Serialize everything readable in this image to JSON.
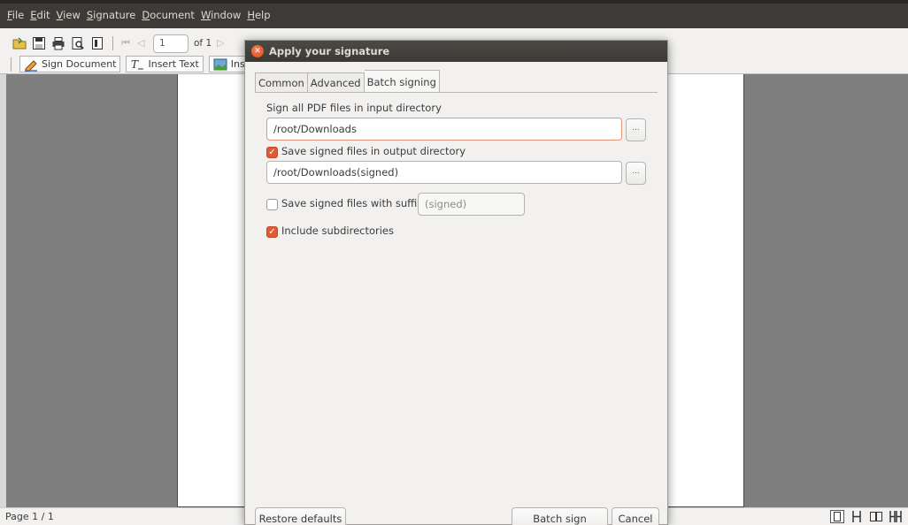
{
  "menubar": {
    "items": [
      "File",
      "Edit",
      "View",
      "Signature",
      "Document",
      "Window",
      "Help"
    ]
  },
  "toolbar": {
    "page_input": "1",
    "of_pages": "of 1",
    "sign_document_label": "Sign Document",
    "insert_text_label": "Insert Text",
    "insert_image_label_partial": "Ins"
  },
  "dialog": {
    "title": "Apply your signature",
    "tabs": [
      {
        "label": "Common",
        "active": false
      },
      {
        "label": "Advanced",
        "active": false
      },
      {
        "label": "Batch signing",
        "active": true
      }
    ],
    "input_dir_label": "Sign all PDF files in input directory",
    "input_dir_value": "/root/Downloads",
    "browse_label": "...",
    "save_output_label": "Save signed files in output directory",
    "save_output_checked": true,
    "output_dir_value": "/root/Downloads(signed)",
    "save_suffix_label": "Save signed files with suffix",
    "save_suffix_checked": false,
    "suffix_placeholder": "(signed)",
    "include_subdirs_label": "Include subdirectories",
    "include_subdirs_checked": true,
    "restore_defaults_label": "Restore defaults",
    "batch_sign_label": "Batch sign",
    "cancel_label": "Cancel"
  },
  "statusbar": {
    "page_status": "Page 1 / 1"
  },
  "colors": {
    "accent": "#de5b36",
    "titlebar": "#3c3b37",
    "document_bg": "#7f7f7f"
  }
}
